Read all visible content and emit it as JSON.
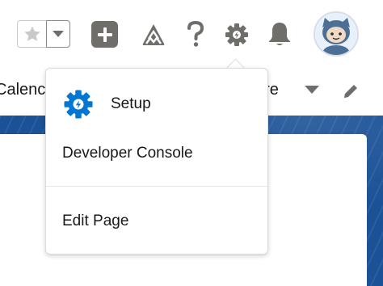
{
  "header": {
    "favorites_icon": "star-icon",
    "favorites_menu_icon": "caret-down-icon",
    "global_actions_icon": "plus-icon",
    "trailhead_icon": "trailhead-icon",
    "help_icon": "question-icon",
    "setup_icon": "gear-icon",
    "notifications_icon": "bell-icon",
    "avatar_icon": "astro-avatar-icon"
  },
  "nav": {
    "partial_left_label": "Calenc",
    "partial_more_label": "ore",
    "more_icon": "caret-down-icon",
    "edit_icon": "pencil-icon"
  },
  "setup_menu": {
    "items": [
      {
        "label": "Setup",
        "icon": "setup-gear-icon"
      },
      {
        "label": "Developer Console"
      },
      {
        "label": "Edit Page"
      }
    ]
  },
  "colors": {
    "icon_gray": "#706e6b",
    "setup_blue": "#0176d3",
    "banner_blue": "#1b5297",
    "text": "#181818"
  }
}
